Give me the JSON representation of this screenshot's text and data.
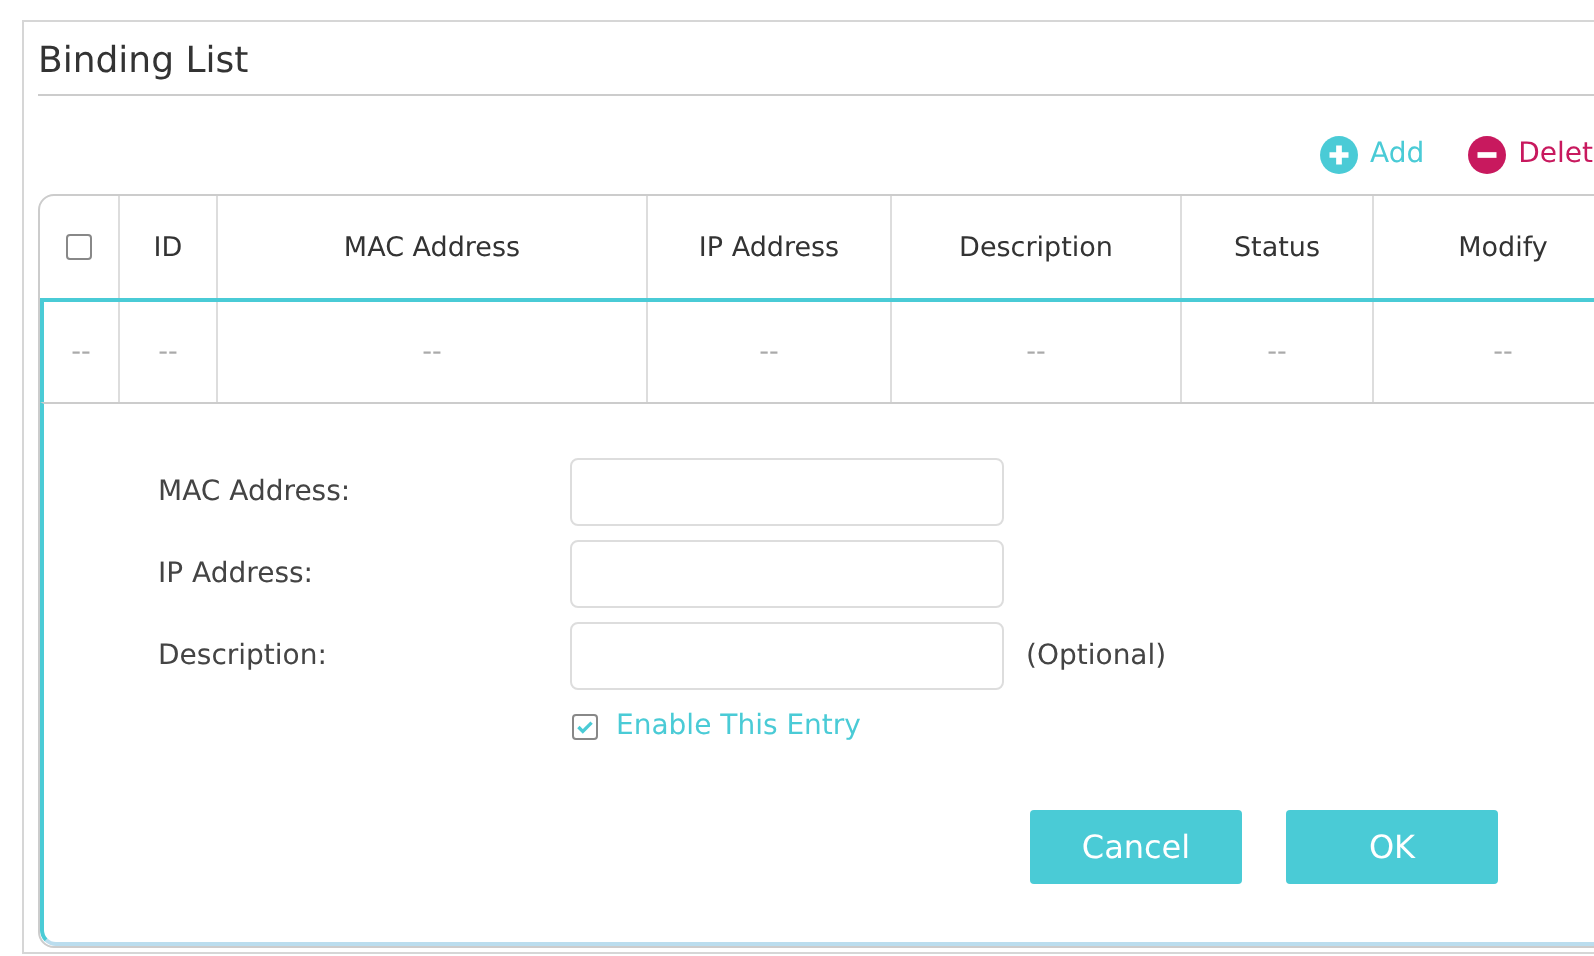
{
  "title": "Binding List",
  "toolbar": [
    {
      "kind": "add",
      "label": "Add"
    },
    {
      "kind": "delete",
      "label": "Delet"
    }
  ],
  "table": {
    "select_all": {
      "checked": false
    },
    "columns": [
      "ID",
      "MAC Address",
      "IP Address",
      "Description",
      "Status",
      "Modify"
    ],
    "rows": [
      {
        "cells": [
          "--",
          "--",
          "--",
          "--",
          "--",
          "--"
        ],
        "checkbox_cell": "--"
      }
    ]
  },
  "form": {
    "fields": [
      {
        "label": "MAC Address:"
      },
      {
        "label": "IP Address:"
      },
      {
        "label": "Description:",
        "note": "(Optional)"
      }
    ],
    "enable": {
      "label": "Enable This Entry",
      "checked": true
    },
    "buttons": [
      "Cancel",
      "OK"
    ]
  }
}
